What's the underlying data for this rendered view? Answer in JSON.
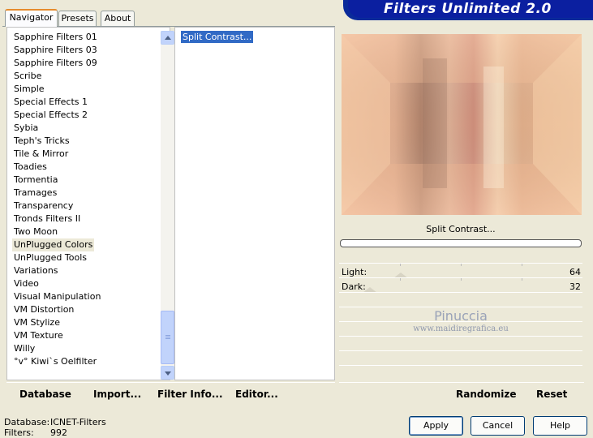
{
  "banner": {
    "title": "Filters Unlimited 2.0"
  },
  "tabs": [
    {
      "label": "Navigator",
      "active": true
    },
    {
      "label": "Presets",
      "active": false
    },
    {
      "label": "About",
      "active": false
    }
  ],
  "categories": [
    "Sapphire Filters 01",
    "Sapphire Filters 03",
    "Sapphire Filters 09",
    "Scribe",
    "Simple",
    "Special Effects 1",
    "Special Effects 2",
    "Sybia",
    "Teph's Tricks",
    "Tile & Mirror",
    "Toadies",
    "Tormentia",
    "Tramages",
    "Transparency",
    "Tronds Filters II",
    "Two Moon",
    "UnPlugged Colors",
    "UnPlugged Tools",
    "Variations",
    "Video",
    "Visual Manipulation",
    "VM Distortion",
    "VM Stylize",
    "VM Texture",
    "Willy",
    "°v° Kiwi`s Oelfilter"
  ],
  "selected_category": "UnPlugged Colors",
  "filters": [
    "Split Contrast..."
  ],
  "preview": {
    "filter_name": "Split Contrast..."
  },
  "sliders": [
    {
      "label": "Light:",
      "value": "64"
    },
    {
      "label": "Dark:",
      "value": "32"
    }
  ],
  "watermark": {
    "name": "Pinuccia",
    "url": "www.maidiregrafica.eu"
  },
  "toolbar": {
    "database": "Database",
    "import": "Import...",
    "filter_info": "Filter Info...",
    "editor": "Editor...",
    "randomize": "Randomize",
    "reset": "Reset"
  },
  "footer": {
    "database_label": "Database:",
    "database_value": "ICNET-Filters",
    "filters_label": "Filters:",
    "filters_value": "992",
    "apply": "Apply",
    "cancel": "Cancel",
    "help": "Help"
  },
  "colors": {
    "banner": "#0b1fa0",
    "selection": "#316ac5",
    "tab_highlight": "#e68b2c"
  }
}
